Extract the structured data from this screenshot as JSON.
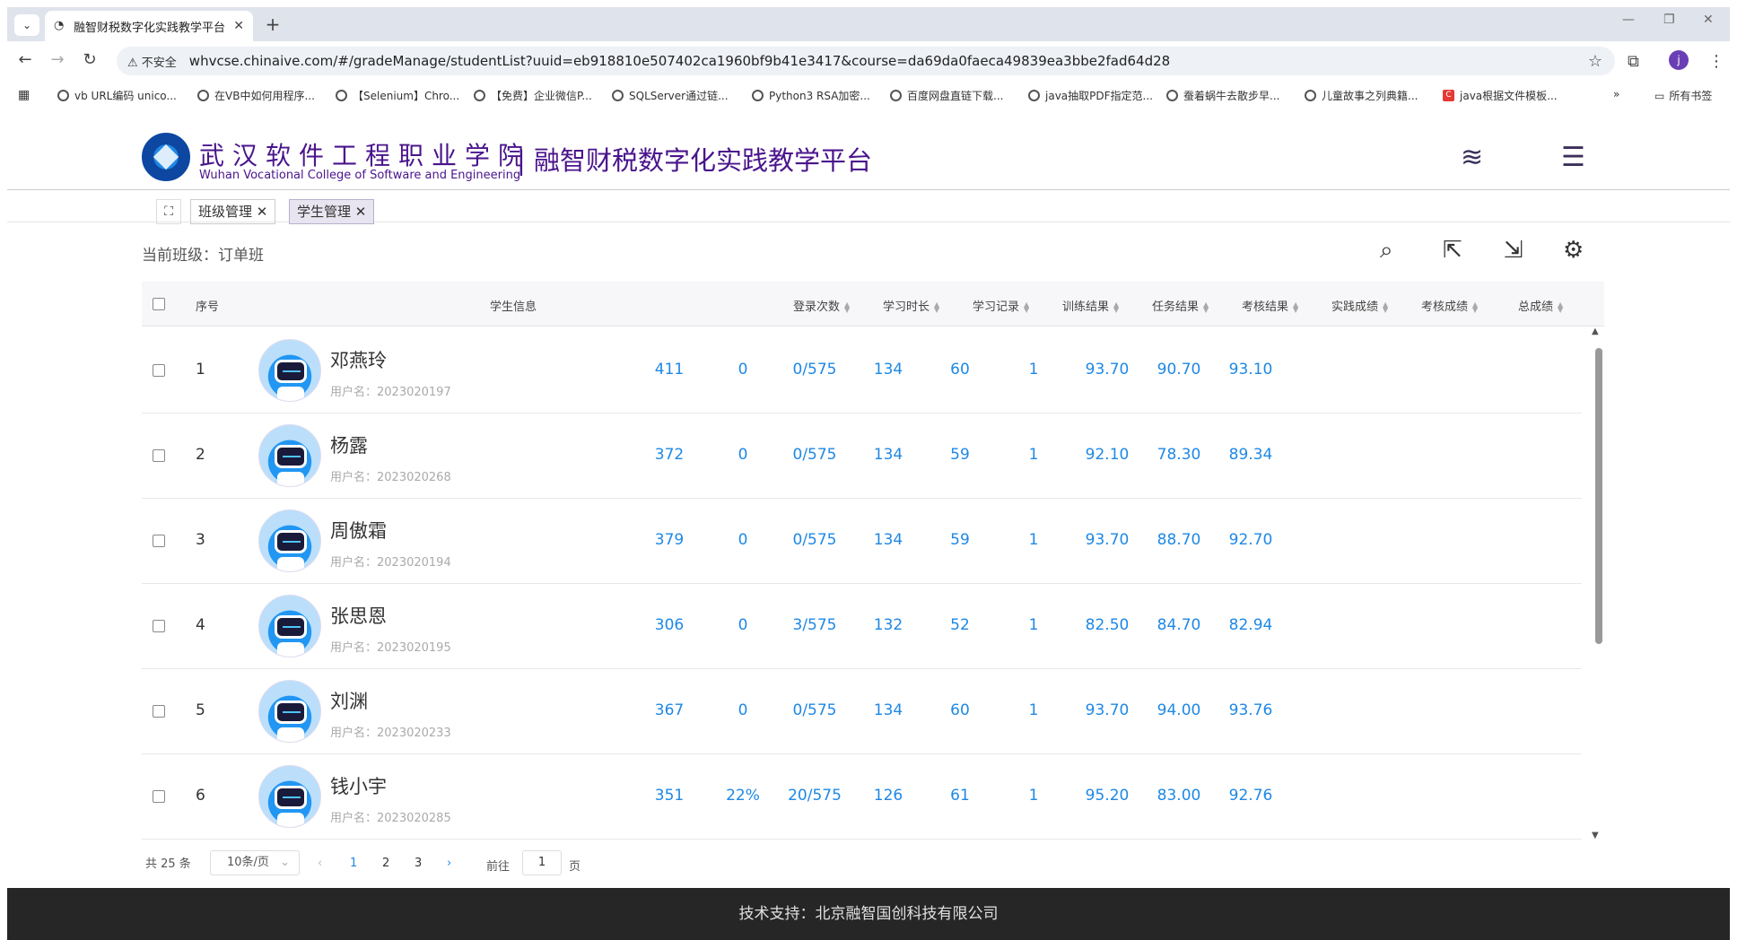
{
  "browser": {
    "tab_title": "融智财税数字化实践教学平台",
    "tab_close": "✕",
    "new_tab": "+",
    "security_label": "⚠ 不安全",
    "url": "whvcse.chinaive.com/#/gradeManage/studentList?uuid=eb918810e507402ca1960bf9b41e3417&course=da69da0faeca49839ea3bbe2fad64d28",
    "profile_initial": "j",
    "bookmarks": [
      "vb URL编码 unico...",
      "在VB中如何用程序...",
      "【Selenium】Chro...",
      "【免费】企业微信P...",
      "SQLServer通过链...",
      "Python3 RSA加密...",
      "百度网盘直链下载...",
      "java抽取PDF指定范...",
      "蚕着蜗牛去散步早...",
      "儿童故事之列典籍...",
      "java根据文件模板..."
    ],
    "bookmarks_more": "»",
    "all_bookmarks": "所有书签"
  },
  "header": {
    "school_cn": "武汉软件工程职业学院",
    "school_en": "Wuhan Vocational College of Software and Engineering",
    "platform_title": "| 融智财税数字化实践教学平台"
  },
  "tags": {
    "expand_icon": "⛶",
    "items": [
      "班级管理 ✕",
      "学生管理 ✕"
    ]
  },
  "current_class_label": "当前班级：订单班",
  "table": {
    "headers": {
      "index": "序号",
      "student_info": "学生信息",
      "logins": "登录次数",
      "study_time": "学习时长",
      "study_records": "学习记录",
      "training_result": "训练结果",
      "task_result": "任务结果",
      "exam_result": "考核结果",
      "practice_score": "实践成绩",
      "exam_score": "考核成绩",
      "total_score": "总成绩"
    },
    "rows": [
      {
        "index": "1",
        "name": "邓燕玲",
        "username": "用户名：2023020197",
        "logins": "411",
        "study_time": "0",
        "study_records": "0/575",
        "training_result": "134",
        "task_result": "60",
        "exam_result": "1",
        "practice_score": "93.70",
        "exam_score": "90.70",
        "total_score": "93.10"
      },
      {
        "index": "2",
        "name": "杨露",
        "username": "用户名：2023020268",
        "logins": "372",
        "study_time": "0",
        "study_records": "0/575",
        "training_result": "134",
        "task_result": "59",
        "exam_result": "1",
        "practice_score": "92.10",
        "exam_score": "78.30",
        "total_score": "89.34"
      },
      {
        "index": "3",
        "name": "周傲霜",
        "username": "用户名：2023020194",
        "logins": "379",
        "study_time": "0",
        "study_records": "0/575",
        "training_result": "134",
        "task_result": "59",
        "exam_result": "1",
        "practice_score": "93.70",
        "exam_score": "88.70",
        "total_score": "92.70"
      },
      {
        "index": "4",
        "name": "张思恩",
        "username": "用户名：2023020195",
        "logins": "306",
        "study_time": "0",
        "study_records": "3/575",
        "training_result": "132",
        "task_result": "52",
        "exam_result": "1",
        "practice_score": "82.50",
        "exam_score": "84.70",
        "total_score": "82.94"
      },
      {
        "index": "5",
        "name": "刘渊",
        "username": "用户名：2023020233",
        "logins": "367",
        "study_time": "0",
        "study_records": "0/575",
        "training_result": "134",
        "task_result": "60",
        "exam_result": "1",
        "practice_score": "93.70",
        "exam_score": "94.00",
        "total_score": "93.76"
      },
      {
        "index": "6",
        "name": "钱小宇",
        "username": "用户名：2023020285",
        "logins": "351",
        "study_time": "22%",
        "study_records": "20/575",
        "training_result": "126",
        "task_result": "61",
        "exam_result": "1",
        "practice_score": "95.20",
        "exam_score": "83.00",
        "total_score": "92.76"
      }
    ]
  },
  "pagination": {
    "total": "共 25 条",
    "page_size": "10条/页",
    "page_size_arrow": "⌄",
    "prev": "‹",
    "pages": [
      "1",
      "2",
      "3"
    ],
    "next": "›",
    "goto_label": "前往",
    "goto_value": "1",
    "goto_suffix": "页"
  },
  "footer": "技术支持：北京融智国创科技有限公司",
  "colors": {
    "accent": "#1e88e5",
    "brand": "#4a148c",
    "footer_bg": "#262626"
  }
}
